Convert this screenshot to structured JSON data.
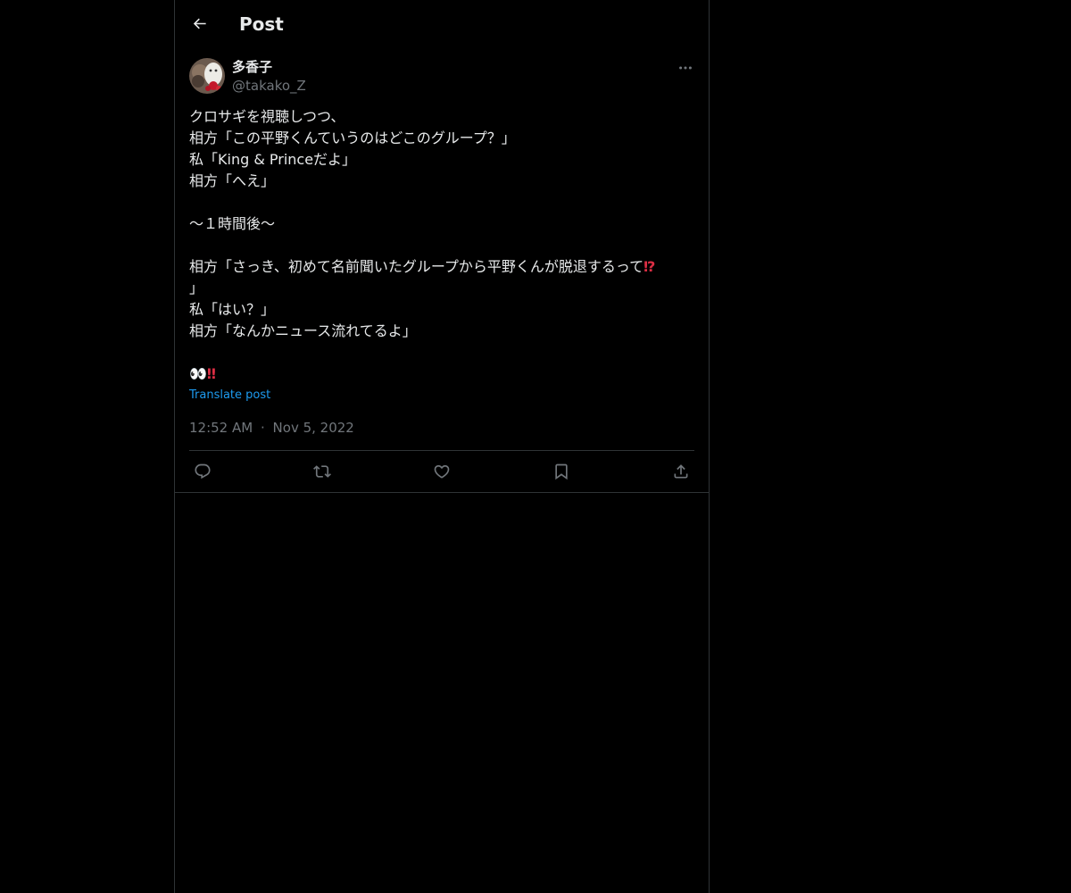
{
  "header": {
    "title": "Post",
    "back_icon": "arrow-left-icon"
  },
  "post": {
    "author": {
      "display_name": "多香子",
      "handle": "@takako_Z",
      "avatar_icon": "avatar-photo"
    },
    "more_icon": "more-horizontal-icon",
    "lines": [
      "クロサギを視聴しつつ、",
      "相方「この平野くんていうのはどこのグループ？」",
      "私「King & Princeだよ」",
      "相方「へえ」",
      "",
      "〜１時間後〜",
      "",
      "相方「さっき、初めて名前聞いたグループから平野くんが脱退するって",
      "」",
      "私「はい？」",
      "相方「なんかニュース流れてるよ」",
      ""
    ],
    "interrobang_emoji": "⁉",
    "final_emoji_eyes": "👀",
    "final_emoji_bang": "‼",
    "translate_label": "Translate post",
    "time": "12:52 AM",
    "separator": "·",
    "date": "Nov 5, 2022"
  },
  "actions": [
    {
      "name": "reply",
      "icon": "reply-icon"
    },
    {
      "name": "repost",
      "icon": "repost-icon"
    },
    {
      "name": "like",
      "icon": "heart-icon"
    },
    {
      "name": "bookmark",
      "icon": "bookmark-icon"
    },
    {
      "name": "share",
      "icon": "share-icon"
    }
  ],
  "colors": {
    "background": "#000000",
    "text": "#e7e9ea",
    "secondary": "#71767b",
    "link": "#1d9bf0",
    "border": "#2f3336",
    "emoji_red": "#dd2e44"
  }
}
